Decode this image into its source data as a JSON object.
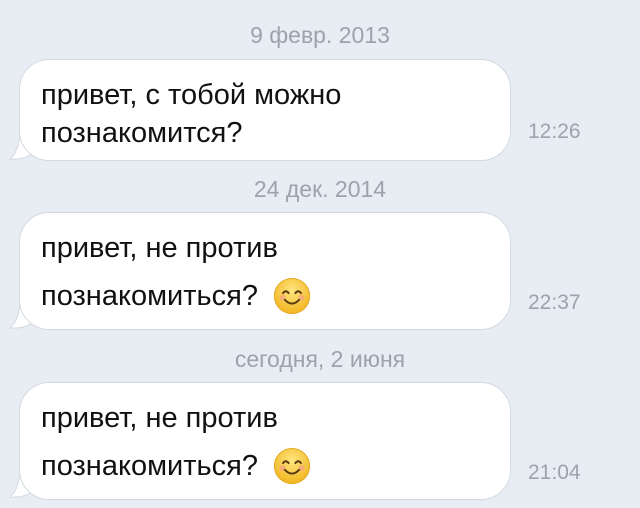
{
  "messages": [
    {
      "date": "9 февр. 2013",
      "line1": "привет, с тобой можно",
      "line2": "познакомится?",
      "emoji": "",
      "time": "12:26"
    },
    {
      "date": "24 дек. 2014",
      "line1": "привет, не против",
      "line2": "познакомиться?",
      "emoji": "smiling-face-icon",
      "time": "22:37"
    },
    {
      "date": "сегодня, 2 июня",
      "line1": "привет, не против",
      "line2": "познакомиться?",
      "emoji": "smiling-face-icon",
      "time": "21:04"
    }
  ],
  "colors": {
    "background": "#e8ecf3",
    "bubble": "#ffffff",
    "bubble_border": "#d4d9e1",
    "meta_text": "#9ba3ae",
    "emoji_face": "#f7c541"
  }
}
